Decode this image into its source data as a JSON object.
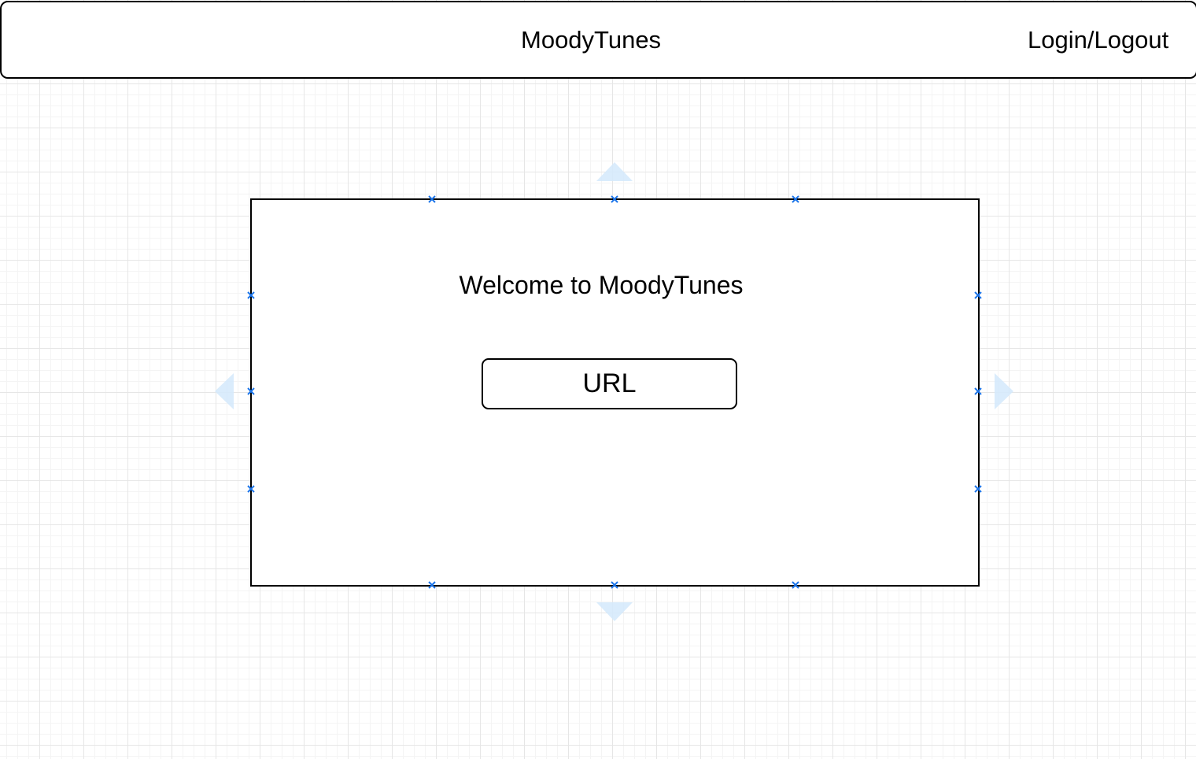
{
  "header": {
    "title": "MoodyTunes",
    "login_label": "Login/Logout"
  },
  "panel": {
    "welcome": "Welcome to MoodyTunes",
    "url_button_label": "URL"
  },
  "colors": {
    "handle": "#1a73e8",
    "arrow": "#d6eafc",
    "border": "#000000"
  }
}
